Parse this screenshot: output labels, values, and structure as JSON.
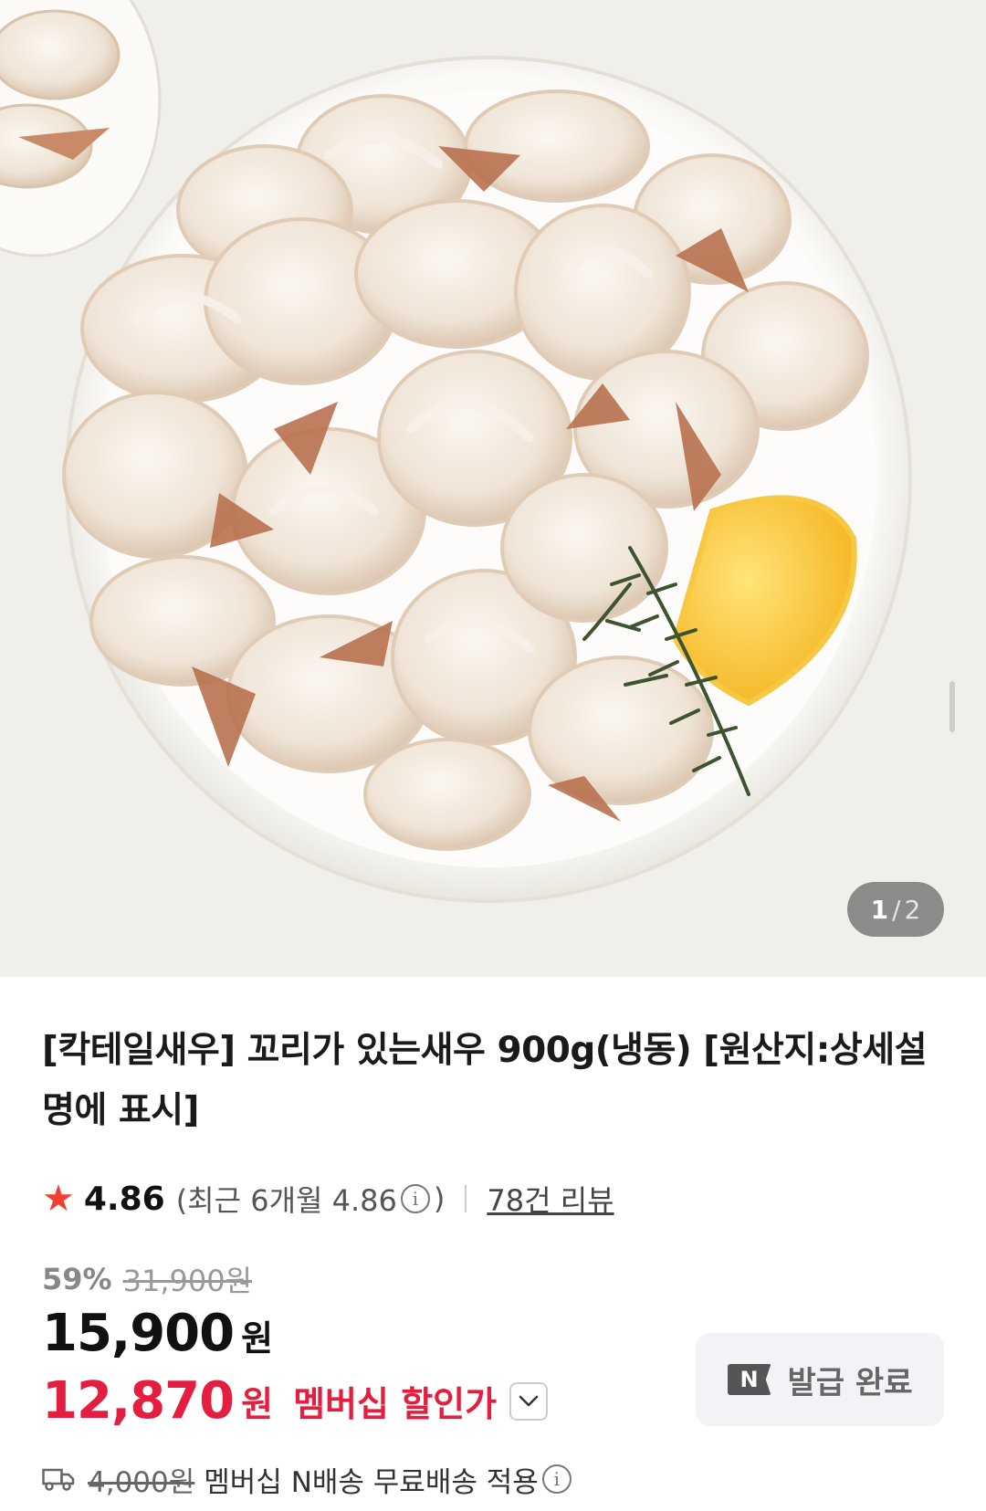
{
  "gallery": {
    "image_alt": "shrimp plate",
    "current": "1",
    "separator": "/",
    "total": "2"
  },
  "product": {
    "title": "[칵테일새우] 꼬리가 있는새우 900g(냉동) [원산지:상세설명에 표시]"
  },
  "rating": {
    "score": "4.86",
    "recent_label": "(최근 6개월 4.86",
    "close_paren": ")",
    "review_link": "78건 리뷰"
  },
  "pricing": {
    "discount_pct": "59%",
    "original_price": "31,900원",
    "sale_price": "15,900",
    "currency": "원",
    "member_price": "12,870",
    "member_currency": "원",
    "member_label": "멤버십 할인가"
  },
  "coupon": {
    "badge": "N",
    "label": "발급 완료"
  },
  "shipping": {
    "original_fee": "4,000원",
    "text": "멤버십 N배송 무료배송 적용"
  },
  "colors": {
    "accent_red": "#e41e3f",
    "star": "#f04030"
  }
}
